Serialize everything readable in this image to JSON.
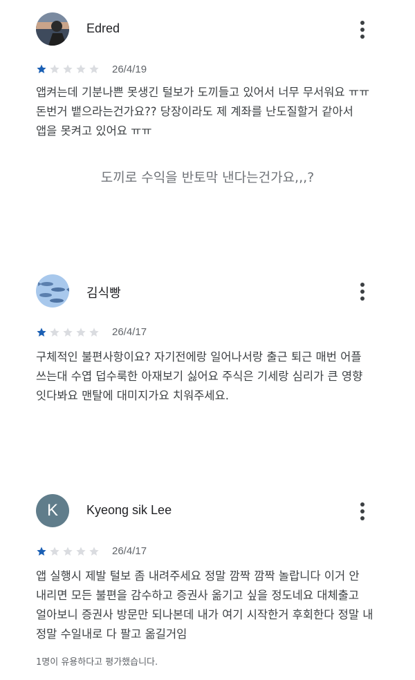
{
  "reviews": [
    {
      "user": "Edred",
      "date": "26/4/19",
      "rating": 1,
      "text": "앱켜는데 기분나쁜 못생긴 털보가 도끼들고 있어서 너무 무서워요 ㅠㅠ\n돈번거 뱉으라는건가요?? 당장이라도 제 계좌를 난도질할거 같아서\n앱을 못켜고 있어요 ㅠㅠ"
    },
    {
      "user": "김식빵",
      "date": "26/4/17",
      "rating": 1,
      "text": "구체적인 불편사항이요? 자기전에랑 일어나서랑 출근 퇴근 매번 어플\n쓰는대 수엽 덥수룩한 아재보기 싫어요 주식은 기세랑 심리가 큰 영향\n잇다봐요 맨탈에 대미지가요 치워주세요."
    },
    {
      "user": "Kyeong sik Lee",
      "avatar_letter": "K",
      "date": "26/4/17",
      "rating": 1,
      "text": "앱 실행시 제발 털보 좀 내려주세요 정말 깜짝 깜짝 놀랍니다 이거 안\n내리면 모든 불편을 감수하고 증권사 옮기고 싶을 정도네요 대체출고\n얼아보니 증권사 방문만 되나본데 내가 여기 시작한거 후회한다 정말 내\n정말 수일내로 다 팔고 옮길거임",
      "helpful": "1명이 유용하다고 평가했습니다."
    }
  ],
  "caption": "도끼로 수익을 반토막 낸다는건가요,,,?",
  "colors": {
    "star_filled": "#1a5fb4",
    "star_empty": "#dadce0",
    "avatar_letter_bg": "#607d8b"
  },
  "icons": [
    "more-vert-icon",
    "star-icon"
  ]
}
